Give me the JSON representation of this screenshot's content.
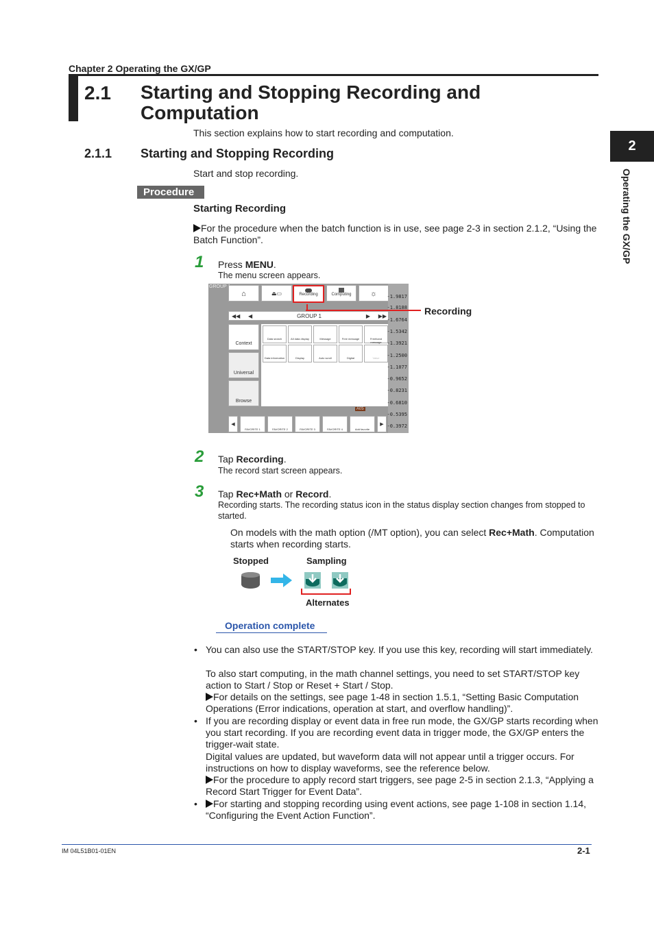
{
  "header": {
    "chapter": "Chapter  2   Operating the GX/GP",
    "section_number": "2.1",
    "section_title": "Starting and Stopping Recording and Computation",
    "intro": "This section explains how to start recording and computation."
  },
  "side_tab": {
    "number": "2",
    "label": "Operating the GX/GP"
  },
  "subsection": {
    "number": "2.1.1",
    "title": "Starting and Stopping Recording",
    "intro": "Start and stop recording."
  },
  "procedure_label": "Procedure",
  "procedure_heading": "Starting Recording",
  "batch_ref": "For the procedure when the batch function is in use, see page 2-3 in section 2.1.2, “Using the Batch Function”.",
  "steps": [
    {
      "num": "1",
      "pre": "Press ",
      "bold": "MENU",
      "post": ".",
      "desc": "The menu screen appears."
    },
    {
      "num": "2",
      "pre": "Tap ",
      "bold": "Recording",
      "post": ".",
      "desc": "The record start screen appears."
    },
    {
      "num": "3",
      "pre": "Tap ",
      "bold": "Rec+Math",
      "mid": " or ",
      "bold2": "Record",
      "post": ".",
      "desc": "Recording starts. The recording status icon in the status display section changes from stopped to started."
    }
  ],
  "screen": {
    "group_label": "GROUP 1",
    "top_buttons": [
      "",
      "",
      "Recording",
      "Computing",
      ""
    ],
    "group_nav": "GROUP  1",
    "side_tabs": [
      "Context",
      "Universal",
      "Browse"
    ],
    "grid": [
      "Data search",
      "All data display",
      "Message",
      "Free message",
      "Freehand message",
      "Data information",
      "Display",
      "Auto scroll",
      "Digital",
      "Value"
    ],
    "favorites": [
      "FAVORITE 1",
      "FAVORITE 2",
      "FAVORITE 3",
      "FAVORITE 4",
      "Add favorite"
    ],
    "values": [
      "-1.9817",
      "-1.8188",
      "-1.6764",
      "-1.5342",
      "-1.3921",
      "-1.2500",
      "-1.1077",
      "-0.9652",
      "-0.8231",
      "-0.6810",
      "-0.5395",
      "-0.3972"
    ],
    "alarm": "A05"
  },
  "callout": "Recording",
  "math_note": {
    "pre": "On models with the math option (/MT option), you can select ",
    "bold": "Rec+Math",
    "post": ". Computation starts when recording starts."
  },
  "status": {
    "stopped": "Stopped",
    "sampling": "Sampling",
    "alternates": "Alternates",
    "colors": {
      "stopped": "#5a5a5a",
      "arrow": "#33b5e8",
      "sampling": "#0d6b5e",
      "bracket": "#e02020"
    }
  },
  "operation_complete": "Operation complete",
  "notes": [
    "You can also use the START/STOP key. If you use this key, recording will start immediately.",
    "To also start computing, in the math channel settings, you need to set START/STOP key action to Start / Stop or Reset + Start / Stop.",
    "For details on the settings, see page 1-48 in section 1.5.1, “Setting Basic Computation Operations (Error indications, operation at start, and overflow handling)”.",
    "If you are recording display or event data in free run mode, the GX/GP starts recording when you start recording. If you are recording event data in trigger mode, the GX/GP enters the trigger-wait state.",
    "Digital values are updated, but waveform data will not appear until a trigger occurs. For instructions on how to display waveforms, see the reference below.",
    "For the procedure to apply record start triggers, see page 2-5 in section 2.1.3, “Applying a Record Start Trigger for Event Data”.",
    "For starting and stopping recording using event actions, see page 1-108 in section 1.14, “Configuring the Event Action Function”."
  ],
  "footer": {
    "doc_id": "IM 04L51B01-01EN",
    "page": "2-1"
  }
}
